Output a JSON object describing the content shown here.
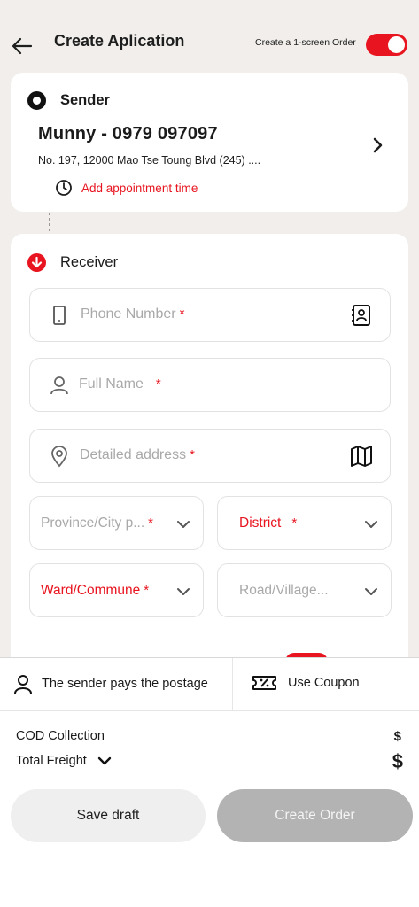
{
  "header": {
    "title": "Create Aplication",
    "one_screen_label": "Create a 1-screen Order",
    "one_screen_enabled": true
  },
  "sender": {
    "section_label": "Sender",
    "name_phone": "Munny - 0979 097097",
    "address": "No. 197, 12000 Mao Tse Toung Blvd (245) ....",
    "appointment_label": "Add appointment time"
  },
  "receiver": {
    "section_label": "Receiver",
    "phone": {
      "placeholder": "Phone Number",
      "required_mark": "*"
    },
    "full_name": {
      "placeholder": "Full Name",
      "required_mark": "*"
    },
    "address": {
      "placeholder": "Detailed address",
      "required_mark": "*"
    },
    "province": {
      "placeholder": "Province/City p...",
      "required_mark": "*"
    },
    "district": {
      "label": "District",
      "required_mark": "*"
    },
    "ward": {
      "label": "Ward/Commune",
      "required_mark": "*"
    },
    "road": {
      "placeholder": "Road/Village..."
    }
  },
  "payment": {
    "payer_label": "The sender pays the postage",
    "coupon_label": "Use Coupon"
  },
  "summary": {
    "cod_label": "COD Collection",
    "cod_value": "$",
    "freight_label": "Total Freight",
    "freight_value": "$"
  },
  "actions": {
    "save_draft": "Save draft",
    "create_order": "Create Order"
  },
  "colors": {
    "accent": "#e8141f",
    "background": "#f1eeeb",
    "placeholder": "#a9a9a9",
    "disabled_button": "#b3b3b3"
  }
}
